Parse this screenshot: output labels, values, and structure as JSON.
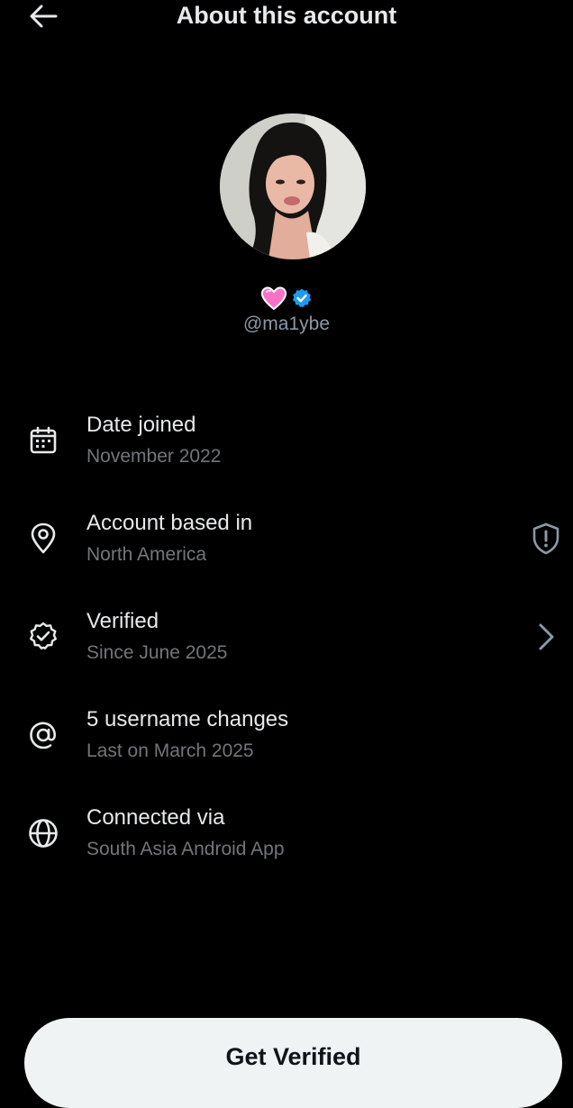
{
  "header": {
    "title": "About this account",
    "back_icon": "arrow-left-icon"
  },
  "profile": {
    "name_emoji": "pink-heart-emoji",
    "verified_badge": "verified-badge-icon",
    "handle": "@ma1ybe"
  },
  "info_items": [
    {
      "icon": "calendar-icon",
      "title": "Date joined",
      "subtitle": "November 2022"
    },
    {
      "icon": "location-pin-icon",
      "title": "Account based in",
      "subtitle": "North America",
      "right_icon": "shield-alert-icon"
    },
    {
      "icon": "verified-check-icon",
      "title": "Verified",
      "subtitle": "Since June 2025",
      "right_icon": "chevron-right-icon"
    },
    {
      "icon": "at-sign-icon",
      "title": "5 username changes",
      "subtitle": "Last on March 2025"
    },
    {
      "icon": "globe-icon",
      "title": "Connected via",
      "subtitle": "South Asia Android App"
    }
  ],
  "cta": {
    "label": "Get Verified"
  },
  "colors": {
    "background": "#000000",
    "text_primary": "#e7e9ea",
    "text_secondary": "#71767b",
    "verified_blue": "#1d9bf0",
    "button_bg": "#eff3f4",
    "button_text": "#0f1419"
  }
}
